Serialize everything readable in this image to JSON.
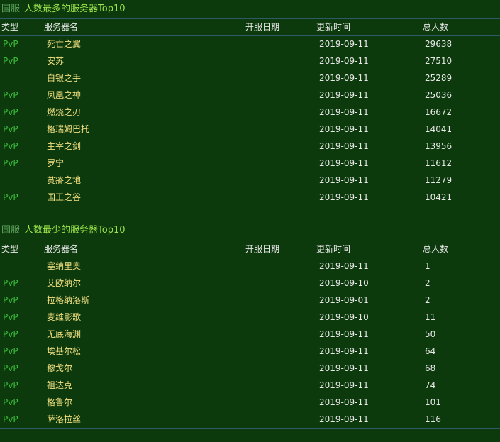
{
  "most": {
    "region": "国服",
    "title": "人数最多的服务器Top10",
    "headers": {
      "type": "类型",
      "name": "服务器名",
      "open_date": "开服日期",
      "updated": "更新时间",
      "total": "总人数"
    },
    "rows": [
      {
        "type": "PvP",
        "name": "死亡之翼",
        "open_date": "",
        "updated": "2019-09-11",
        "total": "29638"
      },
      {
        "type": "PvP",
        "name": "安苏",
        "open_date": "",
        "updated": "2019-09-11",
        "total": "27510"
      },
      {
        "type": "",
        "name": "白银之手",
        "open_date": "",
        "updated": "2019-09-11",
        "total": "25289"
      },
      {
        "type": "PvP",
        "name": "凤凰之神",
        "open_date": "",
        "updated": "2019-09-11",
        "total": "25036"
      },
      {
        "type": "PvP",
        "name": "燃烧之刃",
        "open_date": "",
        "updated": "2019-09-11",
        "total": "16672"
      },
      {
        "type": "PvP",
        "name": "格瑞姆巴托",
        "open_date": "",
        "updated": "2019-09-11",
        "total": "14041"
      },
      {
        "type": "PvP",
        "name": "主宰之剑",
        "open_date": "",
        "updated": "2019-09-11",
        "total": "13956"
      },
      {
        "type": "PvP",
        "name": "罗宁",
        "open_date": "",
        "updated": "2019-09-11",
        "total": "11612"
      },
      {
        "type": "",
        "name": "贫瘠之地",
        "open_date": "",
        "updated": "2019-09-11",
        "total": "11279"
      },
      {
        "type": "PvP",
        "name": "国王之谷",
        "open_date": "",
        "updated": "2019-09-11",
        "total": "10421"
      }
    ]
  },
  "least": {
    "region": "国服",
    "title": "人数最少的服务器Top10",
    "headers": {
      "type": "类型",
      "name": "服务器名",
      "open_date": "开服日期",
      "updated": "更新时间",
      "total": "总人数"
    },
    "rows": [
      {
        "type": "",
        "name": "塞纳里奥",
        "open_date": "",
        "updated": "2019-09-11",
        "total": "1"
      },
      {
        "type": "PvP",
        "name": "艾欧纳尔",
        "open_date": "",
        "updated": "2019-09-10",
        "total": "2"
      },
      {
        "type": "PvP",
        "name": "拉格纳洛斯",
        "open_date": "",
        "updated": "2019-09-01",
        "total": "2"
      },
      {
        "type": "PvP",
        "name": "麦维影歌",
        "open_date": "",
        "updated": "2019-09-10",
        "total": "11"
      },
      {
        "type": "PvP",
        "name": "无底海渊",
        "open_date": "",
        "updated": "2019-09-11",
        "total": "50"
      },
      {
        "type": "PvP",
        "name": "埃基尔松",
        "open_date": "",
        "updated": "2019-09-11",
        "total": "64"
      },
      {
        "type": "PvP",
        "name": "穆戈尔",
        "open_date": "",
        "updated": "2019-09-11",
        "total": "68"
      },
      {
        "type": "PvP",
        "name": "祖达克",
        "open_date": "",
        "updated": "2019-09-11",
        "total": "74"
      },
      {
        "type": "PvP",
        "name": "格鲁尔",
        "open_date": "",
        "updated": "2019-09-11",
        "total": "101"
      },
      {
        "type": "PvP",
        "name": "萨洛拉丝",
        "open_date": "",
        "updated": "2019-09-11",
        "total": "116"
      }
    ]
  }
}
